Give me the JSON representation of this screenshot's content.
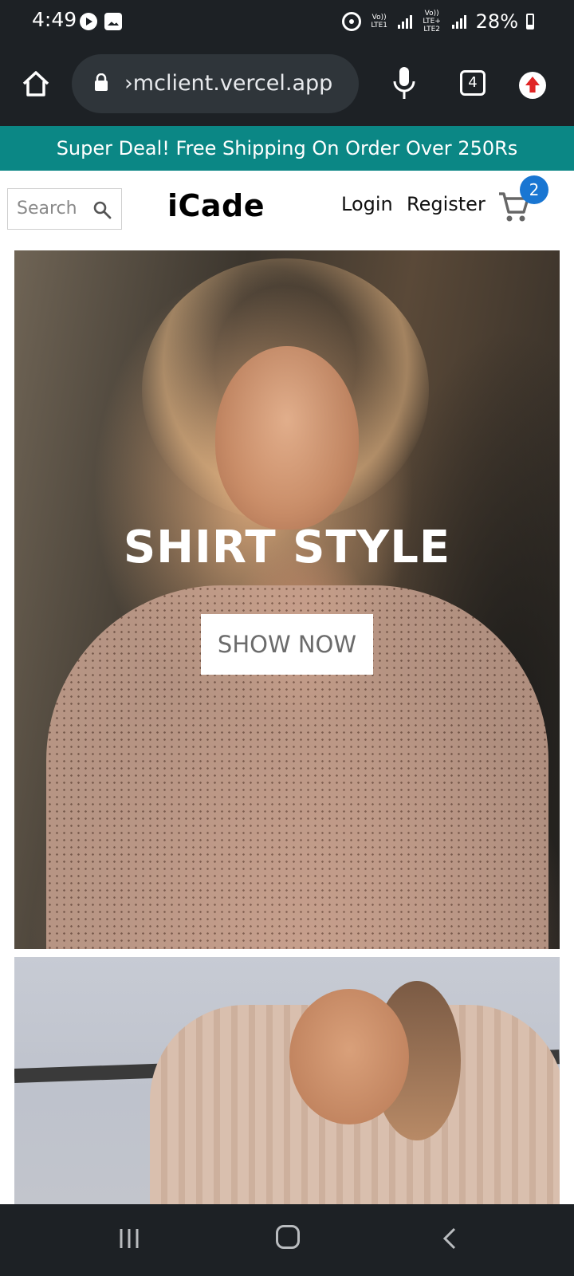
{
  "status_bar": {
    "time": "4:49",
    "sim1_label": "Vo)) LTE1",
    "sim2_label": "Vo)) LTE+ LTE2",
    "battery": "28%",
    "icons": [
      "play-notification-icon",
      "gallery-notification-icon",
      "hotspot-icon",
      "signal-icon",
      "battery-icon"
    ]
  },
  "browser": {
    "url": "›mclient.vercel.app",
    "tab_count": "4",
    "icons": [
      "home-icon",
      "lock-icon",
      "mic-icon",
      "tabs-icon",
      "extension-update-icon"
    ]
  },
  "announcement": {
    "text": "Super Deal! Free Shipping On Order Over 250Rs",
    "bg_color": "#0b8785"
  },
  "header": {
    "search_placeholder": "Search",
    "logo": "iCade",
    "login": "Login",
    "register": "Register",
    "cart_count": "2",
    "badge_color": "#1976d2"
  },
  "hero": {
    "title": "SHIRT STYLE",
    "cta": "SHOW NOW"
  },
  "nav_bar": {
    "icons": [
      "recent-apps-icon",
      "home-icon",
      "back-icon"
    ]
  }
}
